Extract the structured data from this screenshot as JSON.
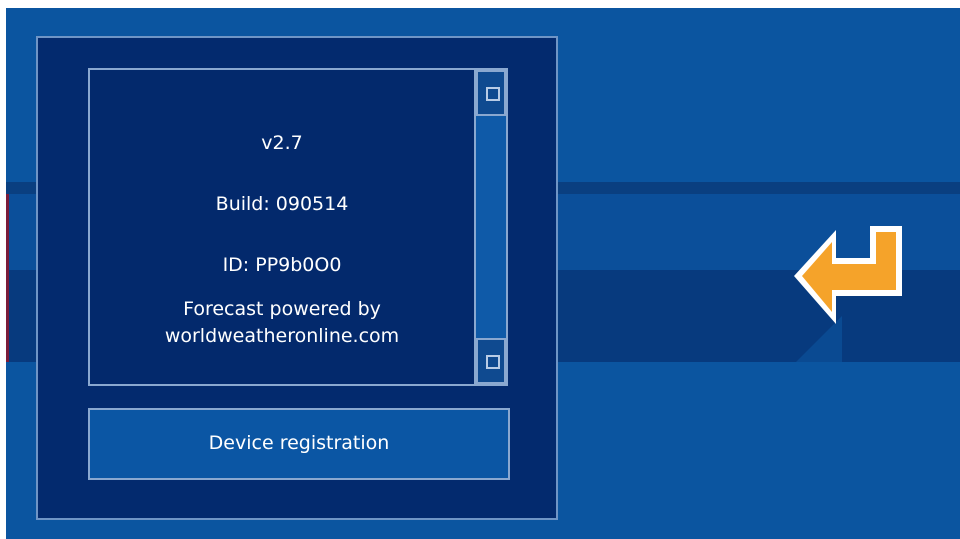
{
  "about": {
    "version": "v2.7",
    "build": "Build: 090514",
    "id": "ID: PP9b0O0",
    "forecast_line1": "Forecast powered by",
    "forecast_line2": "worldweatheronline.com"
  },
  "buttons": {
    "device_registration": "Device registration"
  },
  "icons": {
    "back": "back-arrow-icon",
    "scroll_up": "scroll-up-icon",
    "scroll_down": "scroll-down-icon"
  },
  "colors": {
    "background": "#0b55a0",
    "dialog": "#032a6e",
    "arrow": "#f5a32a"
  }
}
